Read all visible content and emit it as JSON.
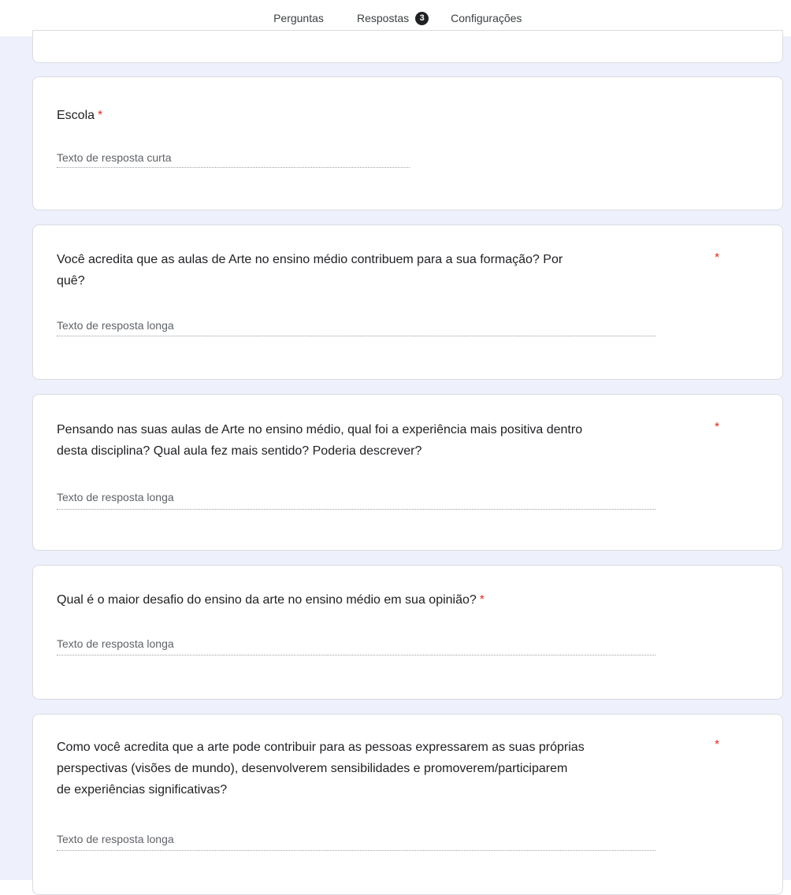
{
  "tabs": {
    "questions": "Perguntas",
    "responses": "Respostas",
    "responses_count": "3",
    "settings": "Configurações"
  },
  "required_mark": "*",
  "questions": [
    {
      "title": "Escola",
      "answer_placeholder": "Texto de resposta curta"
    },
    {
      "lines": [
        "Você acredita que as aulas de Arte no ensino médio contribuem para a sua formação? Por",
        "quê?"
      ],
      "answer_placeholder": "Texto de resposta longa"
    },
    {
      "lines": [
        "Pensando nas suas aulas de Arte no ensino médio, qual foi a experiência mais positiva dentro",
        "desta disciplina? Qual aula fez mais sentido? Poderia descrever?"
      ],
      "answer_placeholder": "Texto de resposta longa"
    },
    {
      "title": "Qual é o maior desafio do ensino da arte no ensino médio em sua opinião?",
      "answer_placeholder": "Texto de resposta longa"
    },
    {
      "lines": [
        "Como você acredita que a arte pode contribuir para as pessoas expressarem as suas próprias",
        "perspectivas (visões de mundo), desenvolverem sensibilidades e promoverem/participarem",
        "de experiências significativas?"
      ],
      "answer_placeholder": "Texto de resposta longa"
    }
  ],
  "colors": {
    "accent": "#673ab7",
    "background": "#eef0fb",
    "required": "#d93025"
  }
}
